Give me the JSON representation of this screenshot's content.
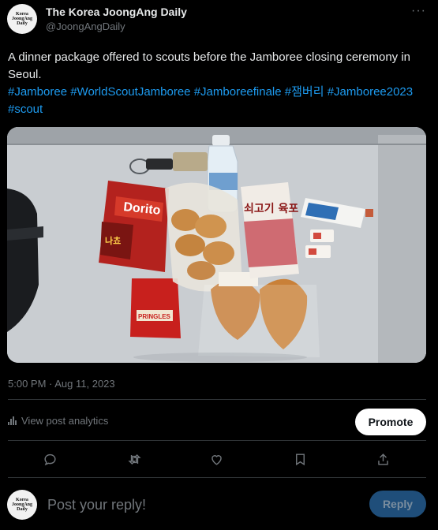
{
  "account": {
    "name": "The Korea JoongAng Daily",
    "handle": "@JoongAngDaily",
    "logo_text": "Korea\nJoongAng\nDaily"
  },
  "more_label": "···",
  "post": {
    "text": "A dinner package offered to scouts before the Jamboree closing ceremony in Seoul.",
    "hashtags": [
      "#Jamboree",
      "#WorldScoutJamboree",
      "#Jamboreefinale",
      "#잼버리",
      "#Jamboree2023",
      "#scout"
    ],
    "timestamp": "5:00 PM · Aug 11, 2023"
  },
  "photo": {
    "items": {
      "chips_brand": "Dorito",
      "chips_flavor": "나쵸",
      "small_snack": "PRINGLES",
      "jerky_text": "쇠고기 육포"
    }
  },
  "analytics": {
    "label": "View post analytics"
  },
  "promote_label": "Promote",
  "actions": [
    "reply-icon",
    "repost-icon",
    "like-icon",
    "bookmark-icon",
    "share-icon"
  ],
  "reply": {
    "placeholder": "Post your reply!",
    "button_label": "Reply"
  },
  "colors": {
    "background": "#000000",
    "text": "#e7e9ea",
    "muted": "#71767b",
    "link": "#1d9bf0",
    "reply_button": "#1f4e7a"
  }
}
